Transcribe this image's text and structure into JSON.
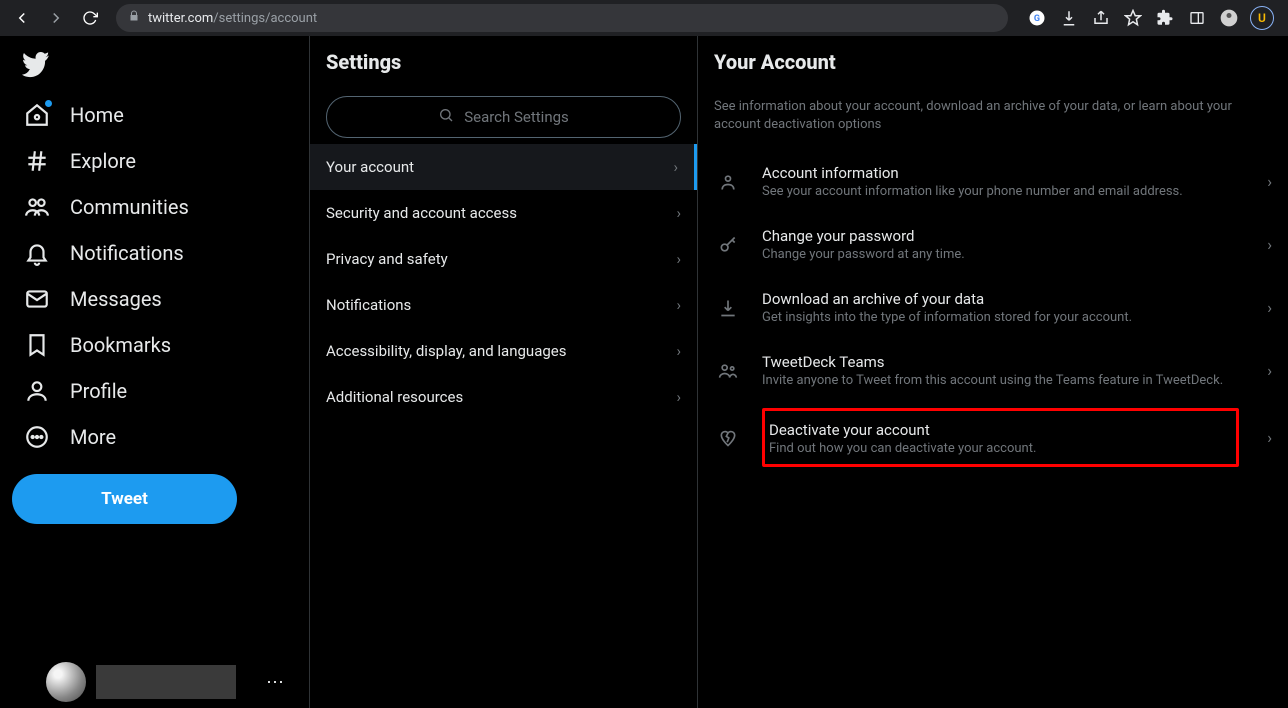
{
  "browser": {
    "url_host": "twitter.com",
    "url_path": "/settings/account",
    "avatar_letter": "U"
  },
  "sidebar": {
    "items": [
      {
        "label": "Home"
      },
      {
        "label": "Explore"
      },
      {
        "label": "Communities"
      },
      {
        "label": "Notifications"
      },
      {
        "label": "Messages"
      },
      {
        "label": "Bookmarks"
      },
      {
        "label": "Profile"
      },
      {
        "label": "More"
      }
    ],
    "tweet_label": "Tweet"
  },
  "settings": {
    "title": "Settings",
    "search_placeholder": "Search Settings",
    "items": [
      {
        "label": "Your account",
        "active": true
      },
      {
        "label": "Security and account access"
      },
      {
        "label": "Privacy and safety"
      },
      {
        "label": "Notifications"
      },
      {
        "label": "Accessibility, display, and languages"
      },
      {
        "label": "Additional resources"
      }
    ]
  },
  "detail": {
    "title": "Your Account",
    "description": "See information about your account, download an archive of your data, or learn about your account deactivation options",
    "options": [
      {
        "title": "Account information",
        "sub": "See your account information like your phone number and email address."
      },
      {
        "title": "Change your password",
        "sub": "Change your password at any time."
      },
      {
        "title": "Download an archive of your data",
        "sub": "Get insights into the type of information stored for your account."
      },
      {
        "title": "TweetDeck Teams",
        "sub": "Invite anyone to Tweet from this account using the Teams feature in TweetDeck."
      },
      {
        "title": "Deactivate your account",
        "sub": "Find out how you can deactivate your account."
      }
    ]
  }
}
